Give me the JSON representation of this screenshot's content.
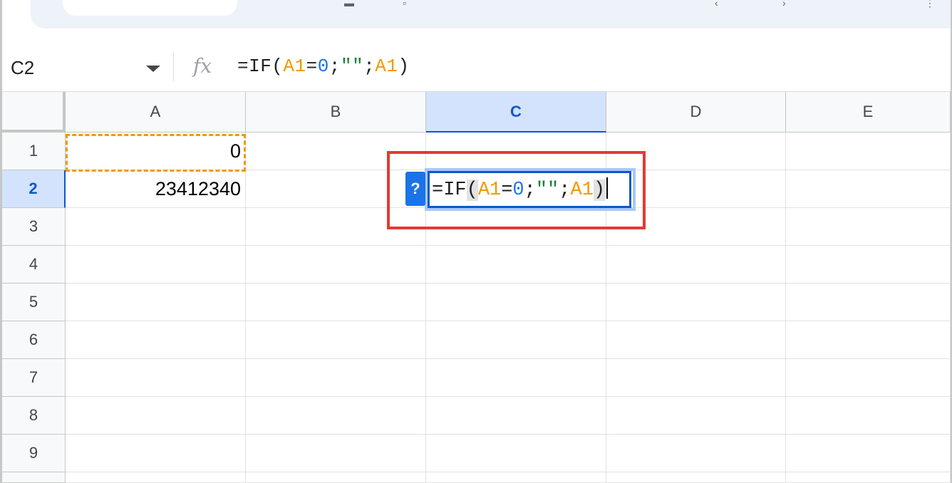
{
  "namebox": {
    "cell_ref": "C2"
  },
  "formula_bar": {
    "fx_label": "fx",
    "parts": [
      "=IF(",
      "A1",
      "=",
      "0",
      ";",
      "\"\"",
      ";",
      "A1",
      ")"
    ]
  },
  "columns": [
    "A",
    "B",
    "C",
    "D",
    "E"
  ],
  "rows": [
    "1",
    "2",
    "3",
    "4",
    "5",
    "6",
    "7",
    "8",
    "9"
  ],
  "cells": {
    "A1": "0",
    "A2": "23412340"
  },
  "editor": {
    "help_label": "?",
    "parts": [
      "=IF",
      "(",
      "A1",
      "=",
      "0",
      ";",
      "\"\"",
      ";",
      "A1",
      ")"
    ]
  },
  "selected": {
    "column": "C",
    "row": "2"
  },
  "colors": {
    "ref": "#f29900",
    "number": "#1a73e8",
    "string": "#188038",
    "selection": "#0b57d0",
    "annotation": "#e53935"
  }
}
